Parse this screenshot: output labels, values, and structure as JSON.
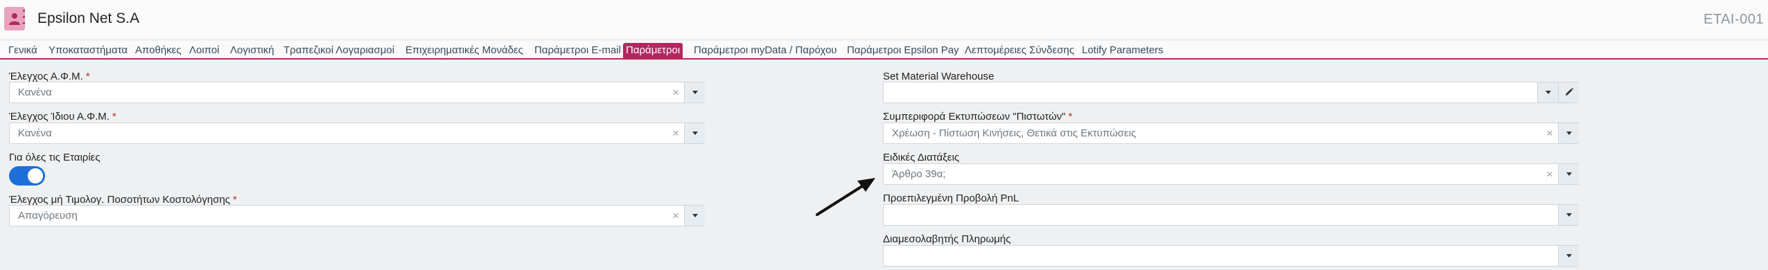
{
  "header": {
    "company": "Epsilon Net S.A",
    "code": "ETAI-001"
  },
  "tabs": [
    {
      "label": "Γενικά",
      "active": false
    },
    {
      "label": "Υποκαταστήματα",
      "active": false
    },
    {
      "label": "Αποθήκες",
      "active": false
    },
    {
      "label": "Λοιποί",
      "active": false
    },
    {
      "label": "Λογιστική",
      "active": false
    },
    {
      "label": "Τραπεζικοί Λογαριασμοί",
      "active": false
    },
    {
      "label": "Επιχειρηματικές Μονάδες",
      "active": false
    },
    {
      "label": "Παράμετροι E-mail",
      "active": false
    },
    {
      "label": "Παράμετροι",
      "active": true
    },
    {
      "label": "Παράμετροι myData / Παρόχου",
      "active": false
    },
    {
      "label": "Παράμετροι Epsilon Pay",
      "active": false
    },
    {
      "label": "Λεπτομέρειες Σύνδεσης",
      "active": false
    },
    {
      "label": "Lotify Parameters",
      "active": false
    }
  ],
  "left": {
    "vat_check": {
      "label": "Έλεγχος Α.Φ.Μ.",
      "required_mark": "*",
      "value": "Κανένα"
    },
    "own_vat_check": {
      "label": "Έλεγχος Ίδιου Α.Φ.Μ.",
      "required_mark": "*",
      "value": "Κανένα"
    },
    "all_companies": {
      "label": "Για όλες τις Εταιρίες",
      "checked": true
    },
    "costing_check": {
      "label": "Έλεγχος μή Τιμολογ. Ποσοτήτων Κοστολόγησης",
      "required_mark": "*",
      "value": "Απαγόρευση"
    }
  },
  "right": {
    "material_warehouse": {
      "label": "Set Material Warehouse",
      "value": ""
    },
    "credit_print": {
      "label": "Συμπεριφορά Εκτυπώσεων \"Πιστωτών\"",
      "required_mark": "*",
      "value": "Χρέωση - Πίστωση Κινήσεις, Θετικά στις Εκτυπώσεις"
    },
    "special_provisions": {
      "label": "Ειδικές Διατάξεις",
      "value": "Άρθρο 39α;"
    },
    "default_pnl": {
      "label": "Προεπιλεγμένη Προβολή PnL",
      "value": ""
    },
    "payment_broker": {
      "label": "Διαμεσολαβητής Πληρωμής",
      "value": ""
    }
  },
  "colors": {
    "accent": "#b2275f",
    "toggle": "#1e6fd9"
  }
}
